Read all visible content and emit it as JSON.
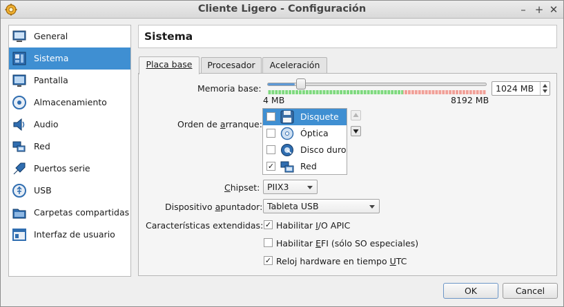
{
  "window": {
    "title": "Cliente Ligero - Configuración"
  },
  "titlebar_buttons": {
    "minimize": "–",
    "maximize": "+",
    "close": "✕"
  },
  "sidebar": {
    "items": [
      {
        "label": "General",
        "icon": "monitor-icon"
      },
      {
        "label": "Sistema",
        "icon": "motherboard-icon",
        "selected": true
      },
      {
        "label": "Pantalla",
        "icon": "display-icon"
      },
      {
        "label": "Almacenamiento",
        "icon": "storage-icon"
      },
      {
        "label": "Audio",
        "icon": "speaker-icon"
      },
      {
        "label": "Red",
        "icon": "network-icon"
      },
      {
        "label": "Puertos serie",
        "icon": "serial-port-icon"
      },
      {
        "label": "USB",
        "icon": "usb-icon"
      },
      {
        "label": "Carpetas compartidas",
        "icon": "shared-folder-icon"
      },
      {
        "label": "Interfaz de usuario",
        "icon": "user-interface-icon"
      }
    ]
  },
  "page": {
    "title": "Sistema"
  },
  "tabs": [
    {
      "label": "Placa base",
      "active": true
    },
    {
      "label": "Procesador"
    },
    {
      "label": "Aceleración"
    }
  ],
  "memory": {
    "label": "Memoria base:",
    "min_label": "4 MB",
    "max_label": "8192 MB",
    "value": "1024 MB",
    "value_mb": 1024,
    "min_mb": 4,
    "max_mb": 8192
  },
  "boot_order": {
    "label": "Orden de arranque:",
    "items": [
      {
        "label": "Disquete",
        "checked": false,
        "selected": true,
        "icon": "floppy-icon"
      },
      {
        "label": "Óptica",
        "checked": false,
        "icon": "optical-disc-icon"
      },
      {
        "label": "Disco duro",
        "checked": false,
        "icon": "hard-disk-icon"
      },
      {
        "label": "Red",
        "checked": true,
        "icon": "network-icon"
      }
    ]
  },
  "chipset": {
    "label": "Chipset:",
    "value": "PIIX3"
  },
  "pointing_device": {
    "label": "Dispositivo apuntador:",
    "value": "Tableta USB"
  },
  "extended": {
    "label": "Características extendidas:",
    "options": [
      {
        "label": "Habilitar I/O APIC",
        "checked": true
      },
      {
        "label": "Habilitar EFI (sólo SO especiales)",
        "checked": false
      },
      {
        "label": "Reloj hardware en tiempo UTC",
        "checked": true
      }
    ]
  },
  "buttons": {
    "ok": "OK",
    "cancel": "Cancel"
  },
  "colors": {
    "selection": "#3f8fd2",
    "scale_green": "#7fd97f",
    "scale_red": "#f0a098"
  }
}
